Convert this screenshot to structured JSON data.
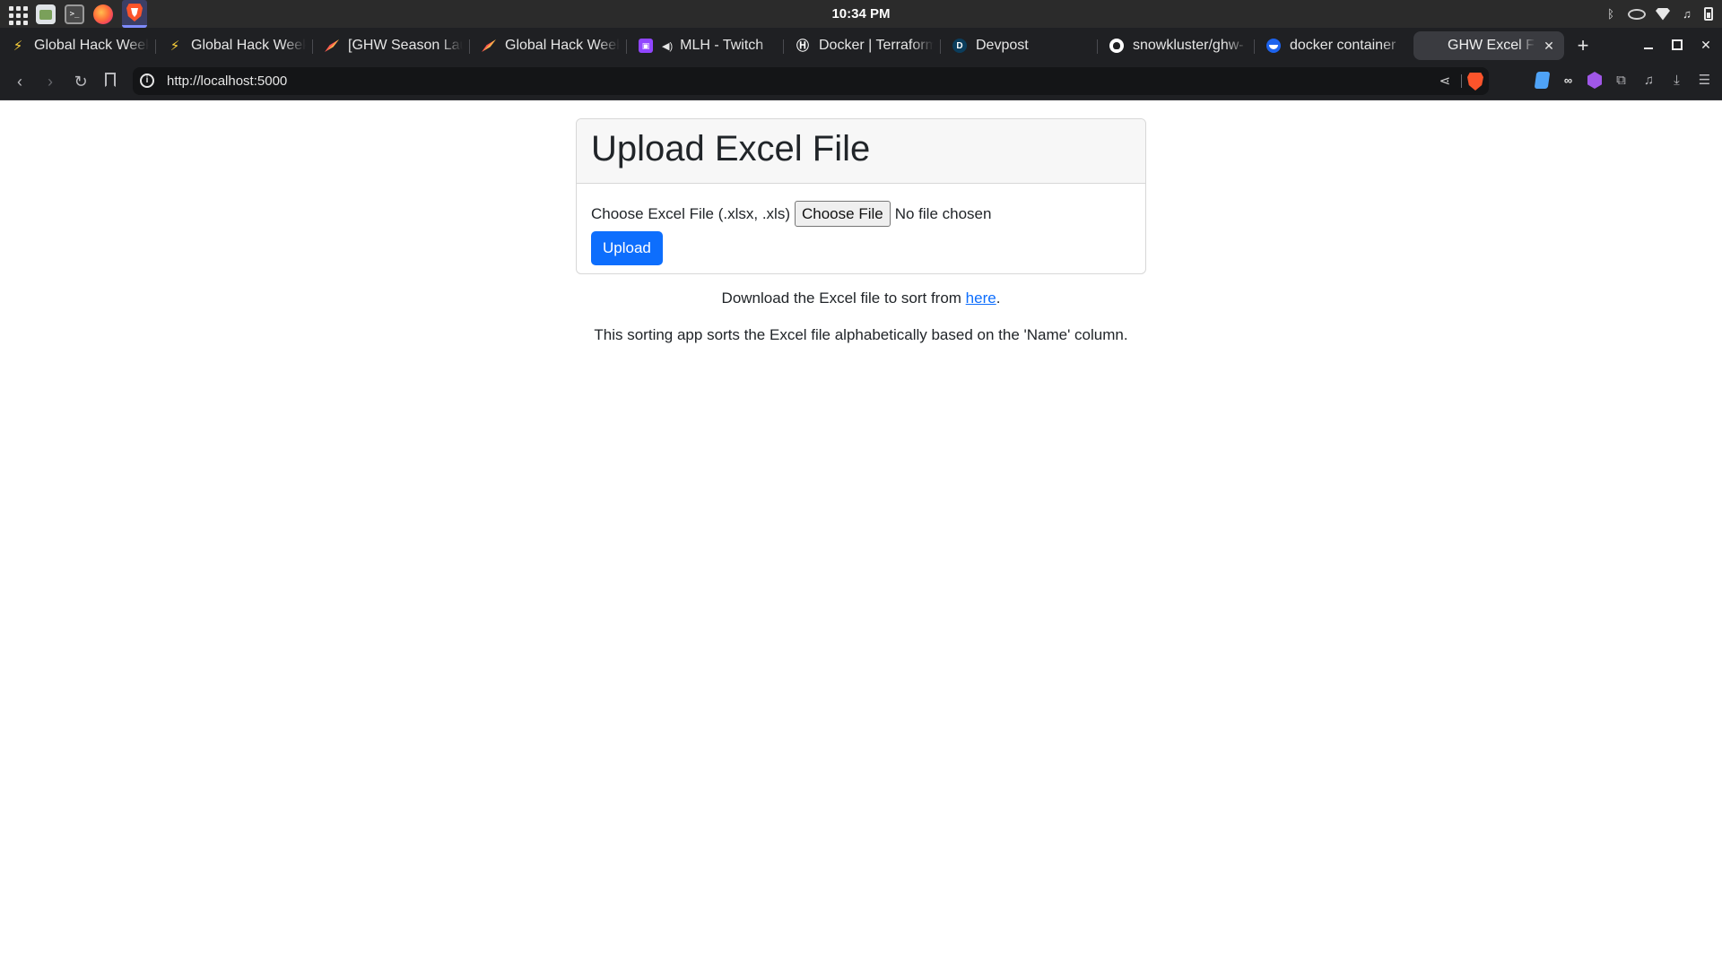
{
  "system": {
    "clock": "10:34 PM"
  },
  "tabs": [
    {
      "label": "Global Hack Week",
      "icon": "bolt-icon"
    },
    {
      "label": "Global Hack Week",
      "icon": "bolt-icon"
    },
    {
      "label": "[GHW Season Lau",
      "icon": "ghw-icon"
    },
    {
      "label": "Global Hack Week",
      "icon": "ghw-icon"
    },
    {
      "label": "MLH - Twitch",
      "icon": "twitch-icon"
    },
    {
      "label": "Docker | Terraform",
      "icon": "hashicorp-icon"
    },
    {
      "label": "Devpost",
      "icon": "devpost-icon"
    },
    {
      "label": "snowkluster/ghw-",
      "icon": "github-icon"
    },
    {
      "label": "docker container",
      "icon": "docker-icon"
    },
    {
      "label": "GHW Excel File",
      "icon": "page-icon",
      "active": true
    }
  ],
  "address_bar": {
    "url": "http://localhost:5000"
  },
  "page": {
    "card_title": "Upload Excel File",
    "file_label": "Choose Excel File (.xlsx, .xls)",
    "file_button": "Choose File",
    "file_status": "No file chosen",
    "upload_button": "Upload",
    "download_text_before": "Download the Excel file to sort from ",
    "download_link": "here",
    "download_text_after": ".",
    "description": "This sorting app sorts the Excel file alphabetically based on the 'Name' column."
  },
  "colors": {
    "primary": "#0d6efd",
    "brave": "#fb542b",
    "chrome_dark": "#1f2023",
    "panel": "#2b2b2b"
  }
}
